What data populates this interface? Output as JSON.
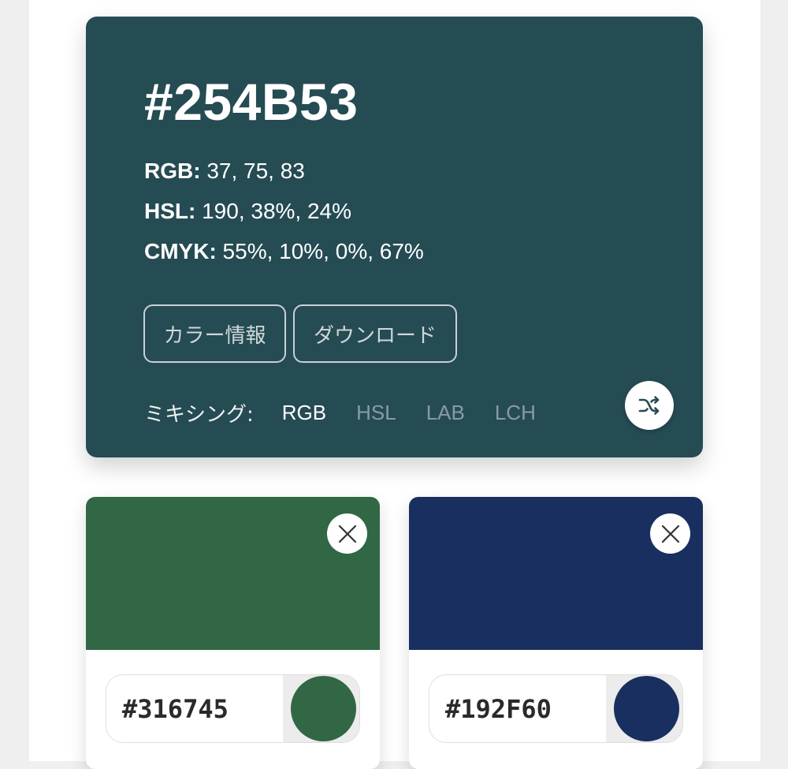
{
  "main": {
    "hex": "#254B53",
    "rgb_label": "RGB:",
    "rgb_value": " 37, 75, 83",
    "hsl_label": "HSL:",
    "hsl_value": " 190, 38%, 24%",
    "cmyk_label": "CMYK:",
    "cmyk_value": " 55%, 10%, 0%, 67%",
    "info_button": "カラー情報",
    "download_button": "ダウンロード",
    "mixing_label": "ミキシング:",
    "mixing_options": [
      "RGB",
      "HSL",
      "LAB",
      "LCH"
    ],
    "mixing_selected": "RGB",
    "shuffle_icon": "shuffle-icon",
    "color": "#254B53"
  },
  "swatches": [
    {
      "hex": "#316745",
      "color": "#316745",
      "close_icon": "close-icon"
    },
    {
      "hex": "#192F60",
      "color": "#192F60",
      "close_icon": "close-icon"
    }
  ]
}
